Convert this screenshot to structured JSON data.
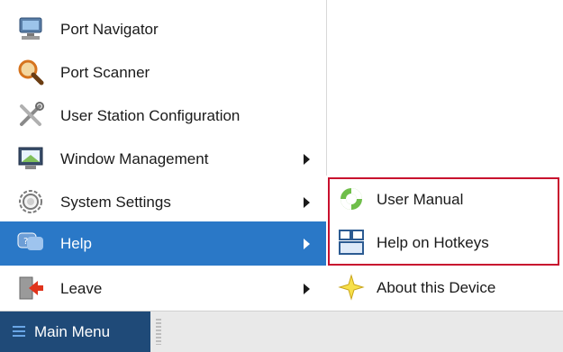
{
  "main_menu": {
    "items": [
      {
        "label": "Port Navigator",
        "icon": "monitor-network-icon",
        "has_submenu": false
      },
      {
        "label": "Port Scanner",
        "icon": "magnifier-icon",
        "has_submenu": false
      },
      {
        "label": "User Station Configuration",
        "icon": "tools-icon",
        "has_submenu": false
      },
      {
        "label": "Window Management",
        "icon": "window-monitor-icon",
        "has_submenu": true
      },
      {
        "label": "System Settings",
        "icon": "gear-icon",
        "has_submenu": true
      },
      {
        "label": "Help",
        "icon": "help-chat-icon",
        "has_submenu": true,
        "active": true
      },
      {
        "label": "Leave",
        "icon": "exit-door-icon",
        "has_submenu": true
      }
    ]
  },
  "help_submenu": {
    "items": [
      {
        "label": "User Manual",
        "icon": "lifebuoy-icon"
      },
      {
        "label": "Help on Hotkeys",
        "icon": "keyboard-window-icon"
      },
      {
        "label": "About this Device",
        "icon": "star-icon"
      }
    ]
  },
  "taskbar": {
    "start_label": "Main Menu",
    "start_icon": "hamburger-icon"
  },
  "colors": {
    "active_bg": "#2a78c7",
    "taskbar_start_bg": "#1f4a78",
    "highlight_border": "#c8102e"
  }
}
